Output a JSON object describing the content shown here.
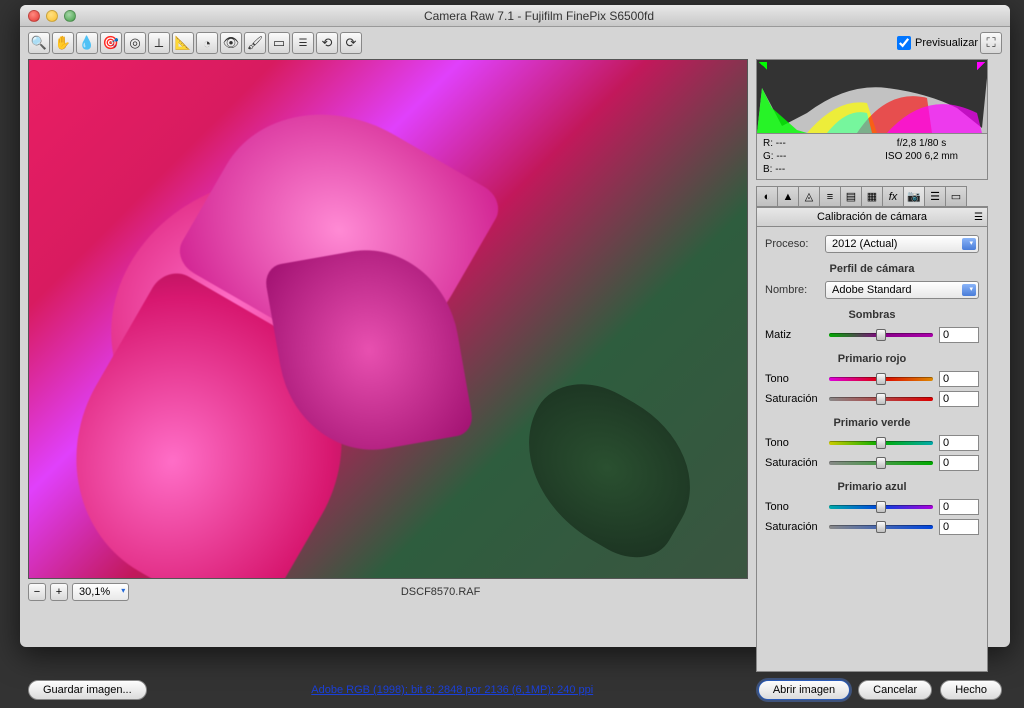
{
  "window": {
    "title": "Camera Raw 7.1  -  Fujifilm FinePix S6500fd"
  },
  "preview_checkbox": "Previsualizar",
  "zoom": {
    "value": "30,1%"
  },
  "filename": "DSCF8570.RAF",
  "rgb": {
    "r": "R:    ---",
    "g": "G:    ---",
    "b": "B:    ---"
  },
  "exif": {
    "line1": "f/2,8    1/80 s",
    "line2": "ISO 200   6,2 mm"
  },
  "panel": {
    "title": "Calibración de cámara",
    "process_label": "Proceso:",
    "process_value": "2012 (Actual)",
    "profile_section": "Perfil de cámara",
    "name_label": "Nombre:",
    "name_value": "Adobe Standard",
    "shadows_section": "Sombras",
    "hue_label": "Matiz",
    "red_section": "Primario rojo",
    "green_section": "Primario verde",
    "blue_section": "Primario azul",
    "tone_label": "Tono",
    "sat_label": "Saturación",
    "zero": "0"
  },
  "buttons": {
    "save": "Guardar imagen...",
    "open": "Abrir imagen",
    "cancel": "Cancelar",
    "done": "Hecho"
  },
  "link": "Adobe RGB (1998); bit 8; 2848 por 2136 (6,1MP); 240 ppi"
}
